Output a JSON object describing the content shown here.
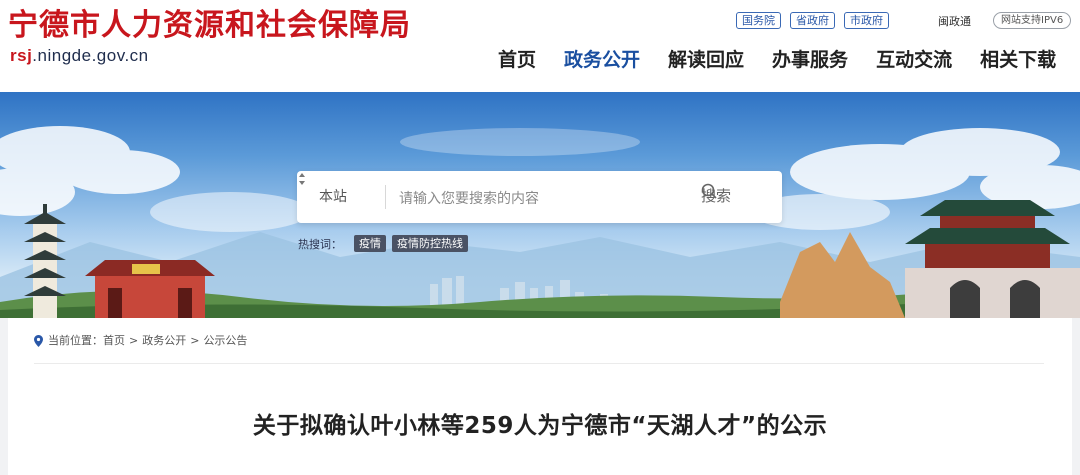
{
  "header": {
    "site_title": "宁德市人力资源和社会保障局",
    "domain_prefix": "rsj",
    "domain_suffix": ".ningde.gov.cn",
    "gov_links": [
      "国务院",
      "省政府",
      "市政府"
    ],
    "min_zheng": "闽政通",
    "ipv6_label": "网站支持IPV6"
  },
  "nav": {
    "items": [
      "首页",
      "政务公开",
      "解读回应",
      "办事服务",
      "互动交流",
      "相关下载"
    ],
    "active_index": 1,
    "active_color": "#1a4fa0"
  },
  "search": {
    "scope": "本站",
    "placeholder": "请输入您要搜索的内容",
    "button_label": "搜索",
    "hot_label": "热搜词：",
    "hot_words": [
      "疫情",
      "疫情防控热线"
    ]
  },
  "breadcrumb": {
    "label": "当前位置：",
    "items": [
      "首页",
      "政务公开",
      "公示公告"
    ],
    "separator": ">"
  },
  "article": {
    "title": "关于拟确认叶小林等259人为宁德市“天湖人才”的公示"
  },
  "colors": {
    "brand_red": "#c8161d",
    "link_blue": "#2a58a8"
  }
}
